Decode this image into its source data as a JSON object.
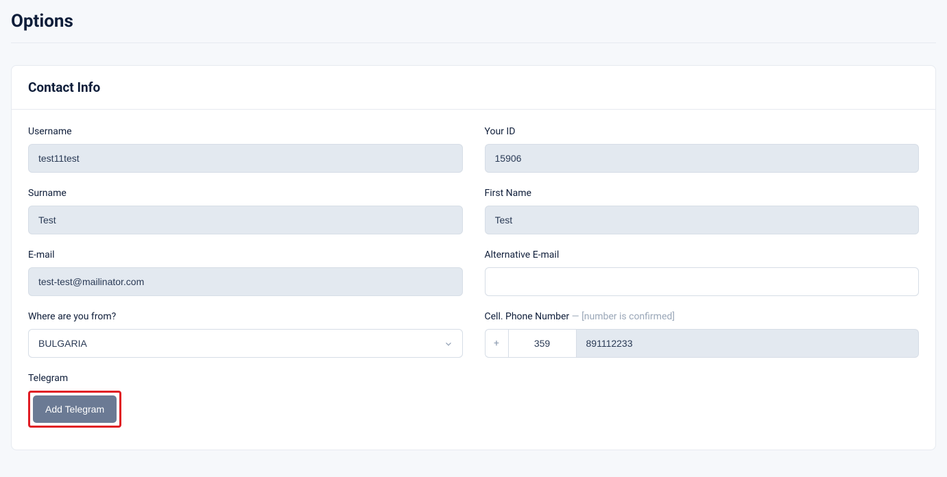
{
  "page": {
    "title": "Options"
  },
  "card": {
    "title": "Contact Info"
  },
  "labels": {
    "username": "Username",
    "your_id": "Your ID",
    "surname": "Surname",
    "first_name": "First Name",
    "email": "E-mail",
    "alt_email": "Alternative E-mail",
    "where_from": "Where are you from?",
    "cell_phone": "Cell. Phone Number",
    "cell_phone_hint": "[number is confirmed]",
    "telegram": "Telegram"
  },
  "fields": {
    "username": "test11test",
    "your_id": "15906",
    "surname": "Test",
    "first_name": "Test",
    "email": "test-test@mailinator.com",
    "alt_email": "",
    "country": "BULGARIA",
    "phone_plus": "+",
    "phone_code": "359",
    "phone_number": "891112233"
  },
  "buttons": {
    "add_telegram": "Add Telegram"
  }
}
